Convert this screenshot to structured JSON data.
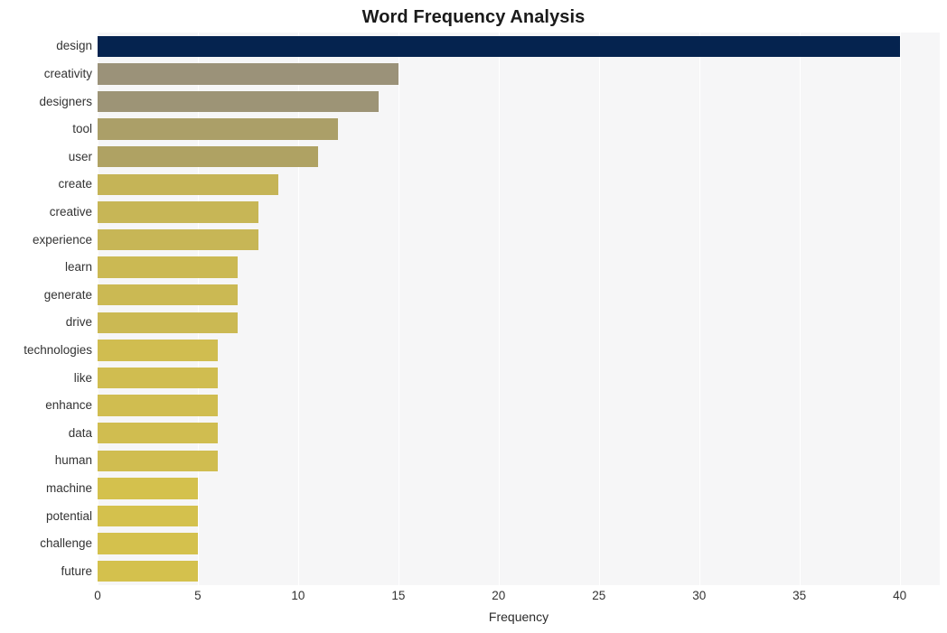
{
  "chart_data": {
    "type": "bar",
    "orientation": "horizontal",
    "title": "Word Frequency Analysis",
    "xlabel": "Frequency",
    "ylabel": "",
    "xlim": [
      0,
      42
    ],
    "ylim": null,
    "grid": true,
    "grid_axis": "x",
    "legend": null,
    "categories": [
      "design",
      "creativity",
      "designers",
      "tool",
      "user",
      "create",
      "creative",
      "experience",
      "learn",
      "generate",
      "drive",
      "technologies",
      "like",
      "enhance",
      "data",
      "human",
      "machine",
      "potential",
      "challenge",
      "future"
    ],
    "values": [
      40,
      15,
      14,
      12,
      11,
      9,
      8,
      8,
      7,
      7,
      7,
      6,
      6,
      6,
      6,
      6,
      5,
      5,
      5,
      5
    ],
    "xticks": [
      0,
      5,
      10,
      15,
      20,
      25,
      30,
      35,
      40
    ],
    "xtick_labels": [
      "0",
      "5",
      "10",
      "15",
      "20",
      "25",
      "30",
      "35",
      "40"
    ],
    "bar_colors": [
      "#05234f",
      "#9b9279",
      "#9d9476",
      "#ab9f68",
      "#afa263",
      "#c5b457",
      "#c7b656",
      "#c7b656",
      "#cbb953",
      "#cbb953",
      "#cbb953",
      "#d0bd50",
      "#d0bd50",
      "#d0bd50",
      "#d0bd50",
      "#d0bd50",
      "#d4c14d",
      "#d4c14d",
      "#d4c14d",
      "#d4c14d"
    ],
    "plot_background": "#f6f6f7",
    "gridline_color": "#ffffff",
    "figure_background": "#ffffff",
    "tick_label_color": "#333333",
    "title_color": "#1a1a1a"
  }
}
